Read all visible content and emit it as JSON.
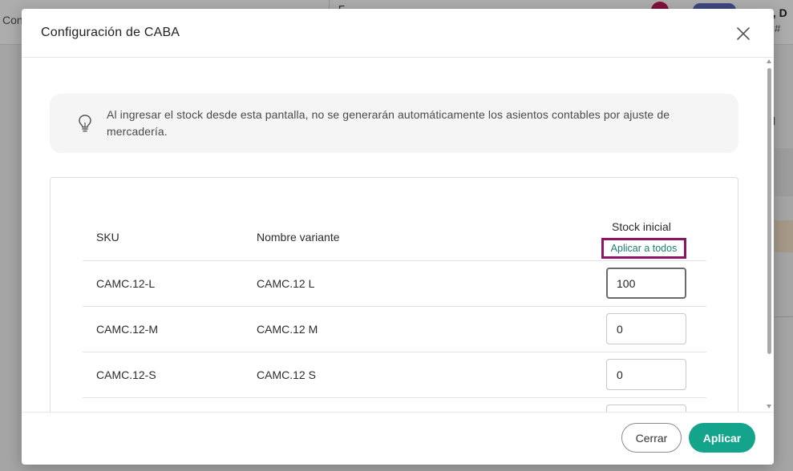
{
  "background": {
    "left_label": "Con",
    "center_snippet": "F",
    "user_name": "a, D",
    "hash": "#",
    "right_letter": "l"
  },
  "modal": {
    "title": "Configuración de CABA",
    "close_icon": "close-icon",
    "info": {
      "icon": "lightbulb-icon",
      "text": "Al ingresar el stock desde esta pantalla, no se generarán automáticamente los asientos contables por ajuste de mercadería."
    },
    "table": {
      "headers": {
        "sku": "SKU",
        "name": "Nombre variante",
        "stock": "Stock inicial"
      },
      "apply_all_label": "Aplicar a todos",
      "rows": [
        {
          "sku": "CAMC.12-L",
          "name": "CAMC.12 L",
          "stock": "100"
        },
        {
          "sku": "CAMC.12-M",
          "name": "CAMC.12 M",
          "stock": "0"
        },
        {
          "sku": "CAMC.12-S",
          "name": "CAMC.12 S",
          "stock": "0"
        }
      ]
    },
    "footer": {
      "close_label": "Cerrar",
      "apply_label": "Aplicar"
    }
  },
  "colors": {
    "accent": "#14a38b",
    "link": "#1b7d6e",
    "highlight_border": "#8e1565"
  }
}
